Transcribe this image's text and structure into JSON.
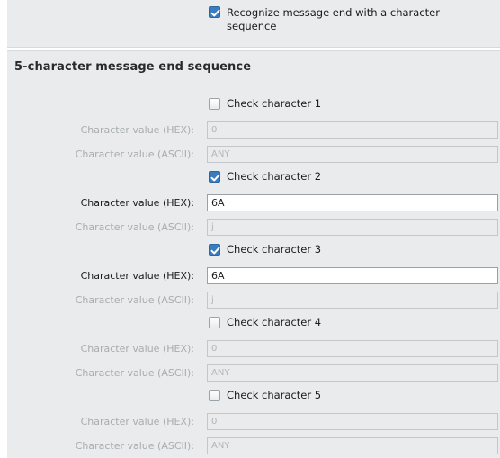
{
  "message_end": {
    "recognize_label": "Recognize message end with a character sequence",
    "recognize_checked": true
  },
  "section": {
    "title": "5-character message end sequence"
  },
  "characters": [
    {
      "check_label": "Check character 1",
      "checked": false,
      "hex_label": "Character value (HEX):",
      "hex_value": "0",
      "ascii_label": "Character value (ASCII):",
      "ascii_value": "ANY"
    },
    {
      "check_label": "Check character 2",
      "checked": true,
      "hex_label": "Character value (HEX):",
      "hex_value": "6A",
      "ascii_label": "Character value (ASCII):",
      "ascii_value": "j"
    },
    {
      "check_label": "Check character 3",
      "checked": true,
      "hex_label": "Character value (HEX):",
      "hex_value": "6A",
      "ascii_label": "Character value (ASCII):",
      "ascii_value": "j"
    },
    {
      "check_label": "Check character 4",
      "checked": false,
      "hex_label": "Character value (HEX):",
      "hex_value": "0",
      "ascii_label": "Character value (ASCII):",
      "ascii_value": "ANY"
    },
    {
      "check_label": "Check character 5",
      "checked": false,
      "hex_label": "Character value (HEX):",
      "hex_value": "0",
      "ascii_label": "Character value (ASCII):",
      "ascii_value": "ANY"
    }
  ],
  "colors": {
    "panel_background": "#e9ebec",
    "checkbox_checked": "#3b7cbf",
    "disabled_text": "#a8adb1"
  }
}
